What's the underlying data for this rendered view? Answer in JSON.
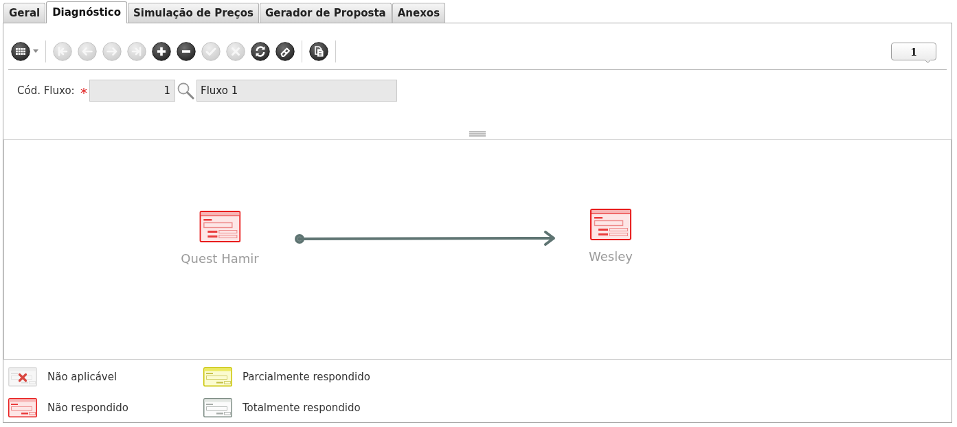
{
  "tabs": [
    {
      "label": "Geral",
      "selected": false
    },
    {
      "label": "Diagnóstico",
      "selected": true
    },
    {
      "label": "Simulação de Preços",
      "selected": false
    },
    {
      "label": "Gerador de Proposta",
      "selected": false
    },
    {
      "label": "Anexos",
      "selected": false
    }
  ],
  "toolbar": {
    "groups": [
      {
        "buttons": [
          {
            "kind": "grid",
            "disabled": false
          }
        ]
      },
      {
        "buttons": [
          {
            "kind": "first",
            "disabled": true
          },
          {
            "kind": "previous",
            "disabled": true
          },
          {
            "kind": "next",
            "disabled": true
          },
          {
            "kind": "last",
            "disabled": true
          },
          {
            "kind": "add",
            "disabled": false
          },
          {
            "kind": "remove",
            "disabled": false
          },
          {
            "kind": "confirm",
            "disabled": true
          },
          {
            "kind": "cancel",
            "disabled": true
          },
          {
            "kind": "refresh",
            "disabled": false
          },
          {
            "kind": "edit",
            "disabled": false
          }
        ]
      },
      {
        "buttons": [
          {
            "kind": "document",
            "disabled": false
          }
        ]
      }
    ],
    "record_counter": "1"
  },
  "form": {
    "label": "Cód. Fluxo:",
    "required_mark": "*",
    "code": "1",
    "description": "Fluxo 1"
  },
  "flow": {
    "nodes": [
      {
        "label": "Quest Hamir",
        "kind": "unanswered"
      },
      {
        "label": "Wesley",
        "kind": "unanswered"
      }
    ]
  },
  "legend": [
    {
      "label": "Não aplicável",
      "kind": "inapplicable"
    },
    {
      "label": "Parcialmente respondido",
      "kind": "partial"
    },
    {
      "label": "Não respondido",
      "kind": "unanswered"
    },
    {
      "label": "Totalmente respondido",
      "kind": "complete"
    }
  ]
}
